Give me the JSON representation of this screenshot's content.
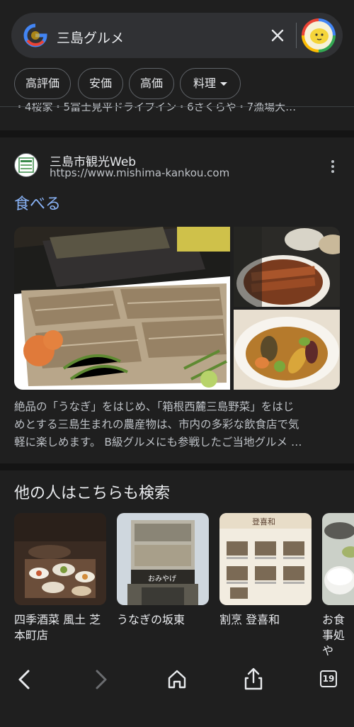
{
  "search": {
    "query": "三島グルメ"
  },
  "chips": [
    {
      "label": "高評価"
    },
    {
      "label": "安価"
    },
    {
      "label": "高価"
    },
    {
      "label": "料理"
    }
  ],
  "truncated_line": "・4桜家・5富士見平ドライブイン・6さくらや・7漁場大…",
  "result": {
    "site_name": "三島市観光Web",
    "url": "https://www.mishima-kankou.com",
    "title": "食べる",
    "snippet_lines": [
      "絶品の「うなぎ」をはじめ、「箱根西麓三島野菜」をはじ",
      "めとする三島生まれの農産物は、市内の多彩な飲食店で気",
      "軽に楽しめます。 B級グルメにも参戦したご当地グルメ …"
    ]
  },
  "people_also_search": {
    "title": "他の人はこちらも検索",
    "items": [
      {
        "label": "四季酒菜 風土 芝本町店"
      },
      {
        "label": "うなぎの坂東"
      },
      {
        "label": "割烹 登喜和"
      },
      {
        "label": "お食事処 や"
      }
    ]
  },
  "thumb_texts": {
    "shop_sign": "おみやげ",
    "menu_title": "登喜和"
  },
  "bottom_nav": {
    "tab_count": "19"
  },
  "colors": {
    "background": "#1f1f1f",
    "link": "#8ab4f8",
    "muted_text": "#bdc1c6"
  }
}
